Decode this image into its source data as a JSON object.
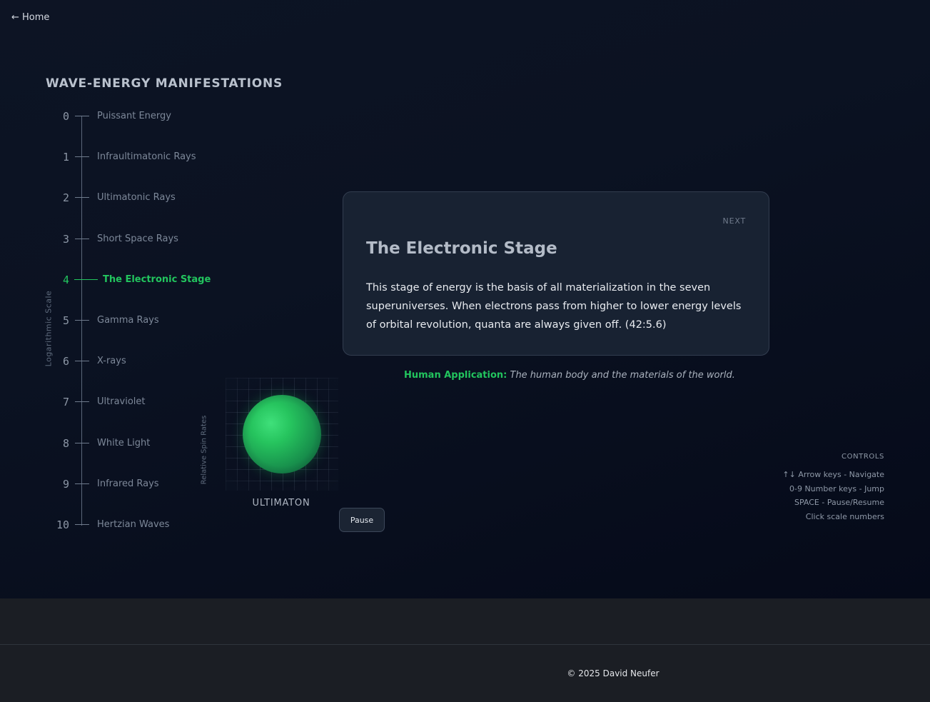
{
  "nav": {
    "home_label": "← Home"
  },
  "title": "WAVE-ENERGY MANIFESTATIONS",
  "scale": {
    "axis_label": "Logarithmic Scale",
    "active_index": 4,
    "accent_color": "#22c55e",
    "items": [
      {
        "number": "0",
        "label": "Puissant Energy"
      },
      {
        "number": "1",
        "label": "Infraultimatonic Rays"
      },
      {
        "number": "2",
        "label": "Ultimatonic Rays"
      },
      {
        "number": "3",
        "label": "Short Space Rays"
      },
      {
        "number": "4",
        "label": "The Electronic Stage"
      },
      {
        "number": "5",
        "label": "Gamma Rays"
      },
      {
        "number": "6",
        "label": "X-rays"
      },
      {
        "number": "7",
        "label": "Ultraviolet"
      },
      {
        "number": "8",
        "label": "White Light"
      },
      {
        "number": "9",
        "label": "Infrared Rays"
      },
      {
        "number": "10",
        "label": "Hertzian Waves"
      }
    ]
  },
  "visualization": {
    "y_label": "Relative Spin Rates",
    "x_label": "ULTIMATON",
    "sphere_color": "#22c55e",
    "pause_label": "Pause"
  },
  "card": {
    "next_label": "NEXT",
    "title": "The Electronic Stage",
    "body": "This stage of energy is the basis of all materialization in the seven superuniverses. When electrons pass from higher to lower energy levels of orbital revolution, quanta are always given off. (42:5.6)"
  },
  "human_application": {
    "label": "Human Application:",
    "text": "The human body and the materials of the world."
  },
  "controls": {
    "title": "CONTROLS",
    "items": [
      "↑↓ Arrow keys - Navigate",
      "0-9 Number keys - Jump",
      "SPACE - Pause/Resume",
      "Click scale numbers"
    ]
  },
  "footer": {
    "copyright": "© 2025 David Neufer"
  }
}
